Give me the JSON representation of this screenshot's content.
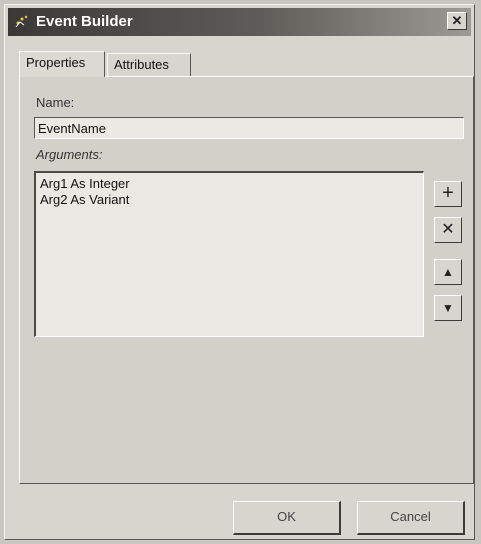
{
  "window": {
    "title": "Event Builder",
    "close_glyph": "✕",
    "title_icon": "event-builder-icon"
  },
  "tabs": [
    {
      "label": "Properties",
      "selected": true
    },
    {
      "label": "Attributes",
      "selected": false
    }
  ],
  "form": {
    "name_label": "Name:",
    "name_value": "EventName",
    "arguments_label": "Arguments:",
    "arguments": [
      "Arg1 As Integer",
      "Arg2 As Variant"
    ]
  },
  "side_buttons": {
    "add_glyph": "+",
    "delete_glyph": "✕",
    "up_glyph": "▲",
    "down_glyph": "▼"
  },
  "buttons": {
    "ok_label": "OK",
    "cancel_label": "Cancel"
  }
}
